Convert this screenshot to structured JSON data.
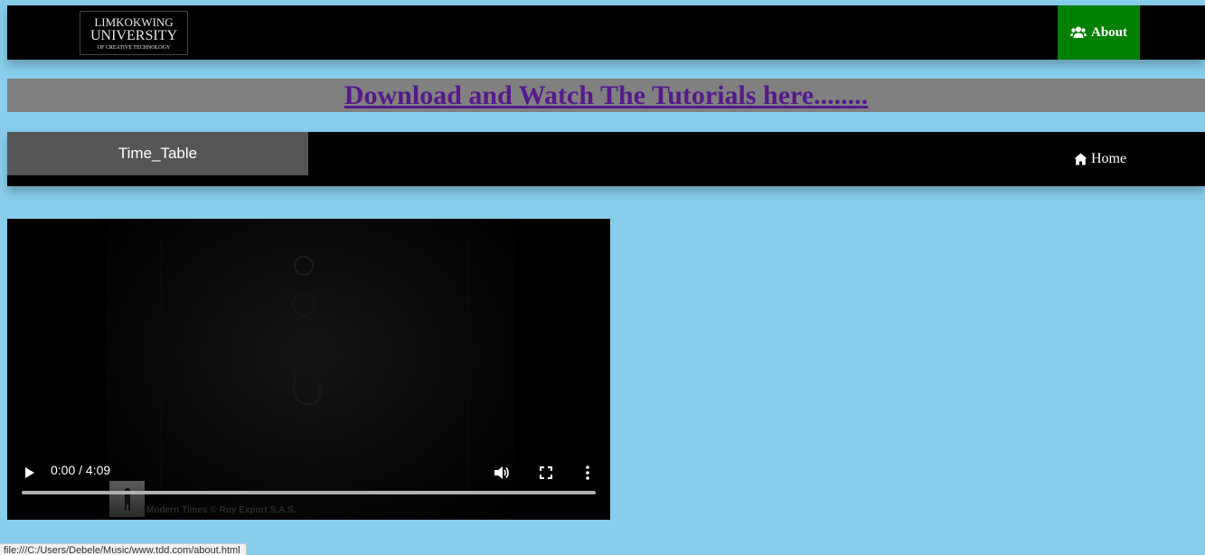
{
  "header": {
    "logo": {
      "line1": "LIMKOKWING",
      "line2": "UNIVERSITY",
      "line3": "OF CREATIVE TECHNOLOGY"
    },
    "about_label": "About",
    "about_icon": "users-icon",
    "about_bg": "#008000"
  },
  "banner": {
    "link_text": "Download and Watch The Tutorials here........",
    "link_color": "#551a8b",
    "bg": "#808080"
  },
  "nav": {
    "time_table_label": "Time_Table",
    "home_label": "Home",
    "home_icon": "home-icon"
  },
  "video": {
    "time_display": "0:00 / 4:09",
    "watermark": "Modern Times © Roy Export S.A.S.",
    "progress": 0
  },
  "status_bar": {
    "url": "file:///C:/Users/Debele/Music/www.tdd.com/about.html"
  },
  "colors": {
    "page_bg": "#87ceeb",
    "nav_bg": "#000000",
    "tab_bg": "#555555"
  }
}
